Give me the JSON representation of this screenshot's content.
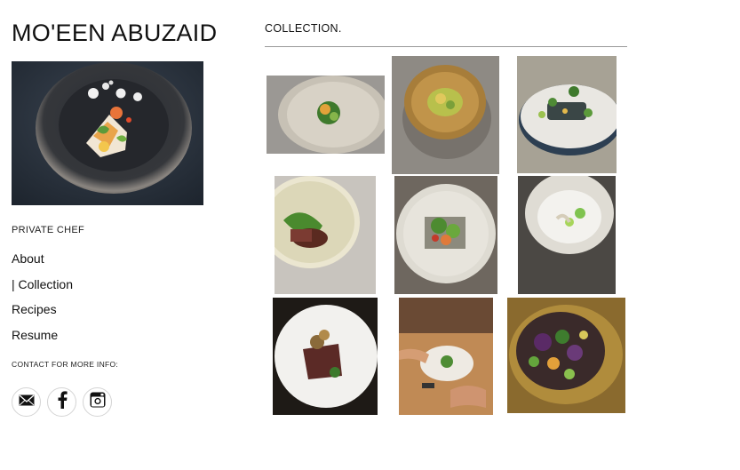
{
  "site": {
    "title": "MO'EEN ABUZAID"
  },
  "sidebar": {
    "tagline": "PRIVATE CHEF",
    "nav": [
      {
        "label": "About"
      },
      {
        "label": "| Collection"
      },
      {
        "label": "Recipes"
      },
      {
        "label": "Resume"
      }
    ],
    "contact_label": "CONTACT FOR MORE INFO:",
    "social": [
      {
        "icon": "mail-icon"
      },
      {
        "icon": "facebook-icon"
      },
      {
        "icon": "instagram-icon"
      }
    ]
  },
  "main": {
    "section_title": "COLLECTION."
  },
  "colors": {
    "text": "#111111",
    "rule": "#9a9a9a",
    "icon_border": "#d4d4d4"
  }
}
